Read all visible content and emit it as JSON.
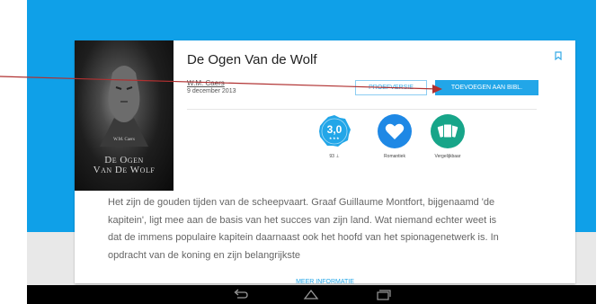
{
  "book": {
    "title": "De Ogen Van de Wolf",
    "author": "W.M. Caers",
    "date": "9 december 2013",
    "cover_author": "W.M. Caers",
    "cover_title_line1": "De Ogen",
    "cover_title_line2": "Van De Wolf"
  },
  "actions": {
    "sample_label": "PROEFVERSIE",
    "add_label": "TOEVOEGEN AAN BIBL."
  },
  "badges": {
    "rating_value": "3,0",
    "rating_stars": "★★★",
    "rating_count": "93 ⊥",
    "genre_label": "Romantiek",
    "similar_label": "Vergelijkbaar"
  },
  "description": {
    "text": "Het zijn de gouden tijden van de scheepvaart. Graaf Guillaume Montfort, bijgenaamd 'de kapitein', ligt mee aan de basis van het succes van zijn land. Wat niemand echter weet is dat de immens populaire kapitein daarnaast ook het hoofd van het spionagenetwerk is. In opdracht van de koning en zijn belangrijkste",
    "more_label": "MEER INFORMATIE"
  },
  "colors": {
    "header_blue": "#0fa0e8",
    "accent_blue": "#22a6e8",
    "genre_blue": "#1e88e5",
    "similar_teal": "#17a589",
    "annotation_red": "#b03030"
  },
  "icons": {
    "bookmark": "bookmark-icon",
    "heart": "heart-icon",
    "cards": "similar-cards-icon",
    "back": "back-icon",
    "home": "home-icon",
    "recents": "recents-icon"
  }
}
